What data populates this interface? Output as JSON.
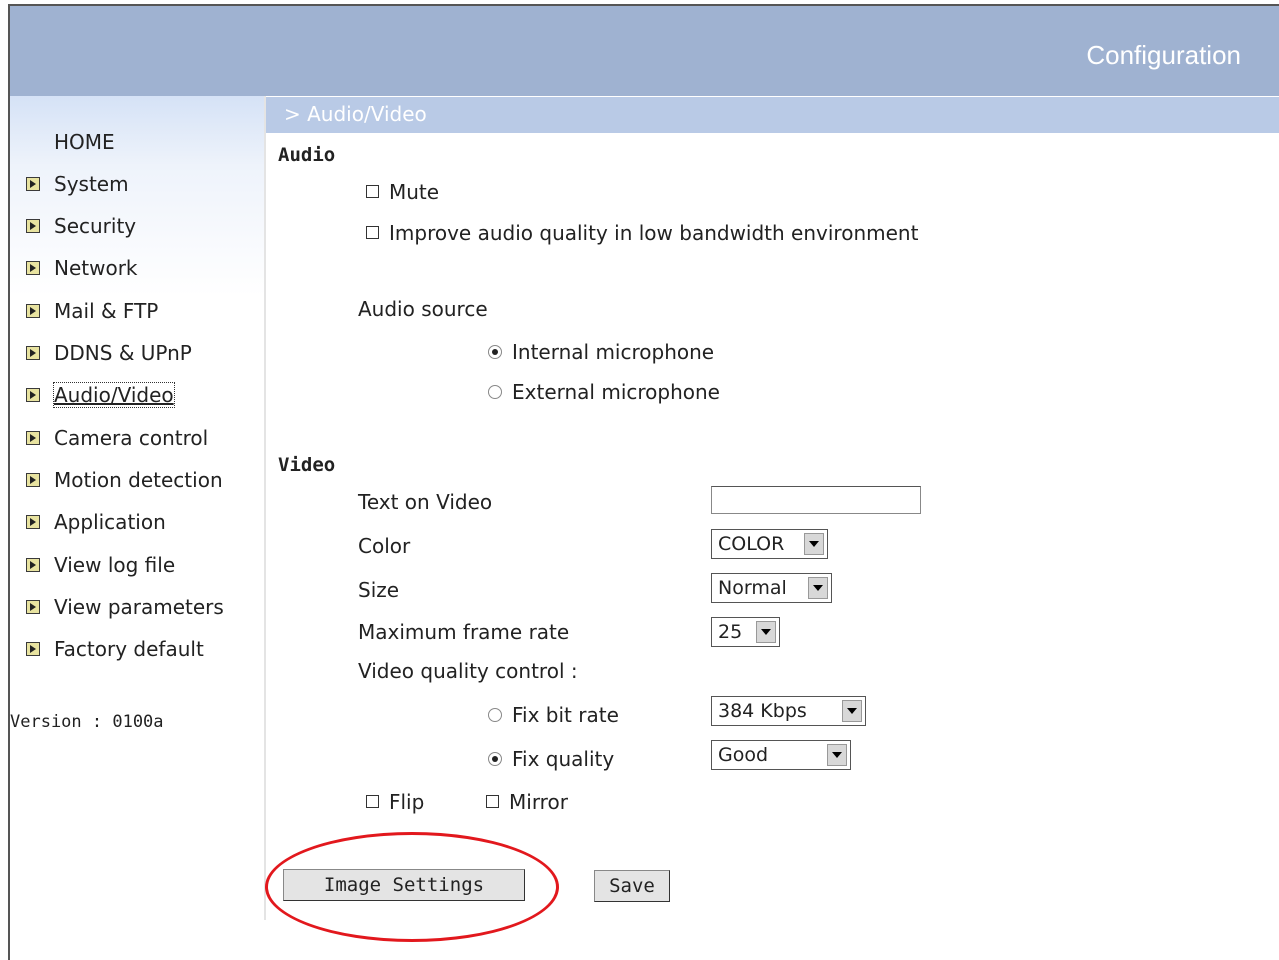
{
  "header": {
    "title": "Configuration"
  },
  "breadcrumb": "> Audio/Video",
  "sidebar": {
    "home": "HOME",
    "items": [
      {
        "label": "System"
      },
      {
        "label": "Security"
      },
      {
        "label": "Network"
      },
      {
        "label": "Mail & FTP"
      },
      {
        "label": "DDNS & UPnP"
      },
      {
        "label": "Audio/Video"
      },
      {
        "label": "Camera control"
      },
      {
        "label": "Motion detection"
      },
      {
        "label": "Application"
      },
      {
        "label": "View log file"
      },
      {
        "label": "View parameters"
      },
      {
        "label": "Factory default"
      }
    ],
    "version": "Version : 0100a"
  },
  "audio": {
    "heading": "Audio",
    "mute_label": "Mute",
    "improve_label": "Improve audio quality in low bandwidth environment",
    "source_label": "Audio source",
    "internal_label": "Internal microphone",
    "external_label": "External microphone",
    "mute_checked": false,
    "improve_checked": false,
    "selected_source": "Internal microphone"
  },
  "video": {
    "heading": "Video",
    "text_on_video_label": "Text on Video",
    "text_on_video_value": "",
    "color_label": "Color",
    "color_value": "COLOR",
    "size_label": "Size",
    "size_value": "Normal",
    "framerate_label": "Maximum frame rate",
    "framerate_value": "25",
    "quality_control_label": "Video quality control :",
    "fix_bitrate_label": "Fix bit rate",
    "bitrate_value": "384 Kbps",
    "fix_quality_label": "Fix quality",
    "quality_value": "Good",
    "selected_mode": "Fix quality",
    "flip_label": "Flip",
    "mirror_label": "Mirror",
    "flip_checked": false,
    "mirror_checked": false
  },
  "buttons": {
    "image_settings": "Image Settings",
    "save": "Save"
  },
  "annotation_color": "#e2181d",
  "header_color": "#9fb2d1"
}
